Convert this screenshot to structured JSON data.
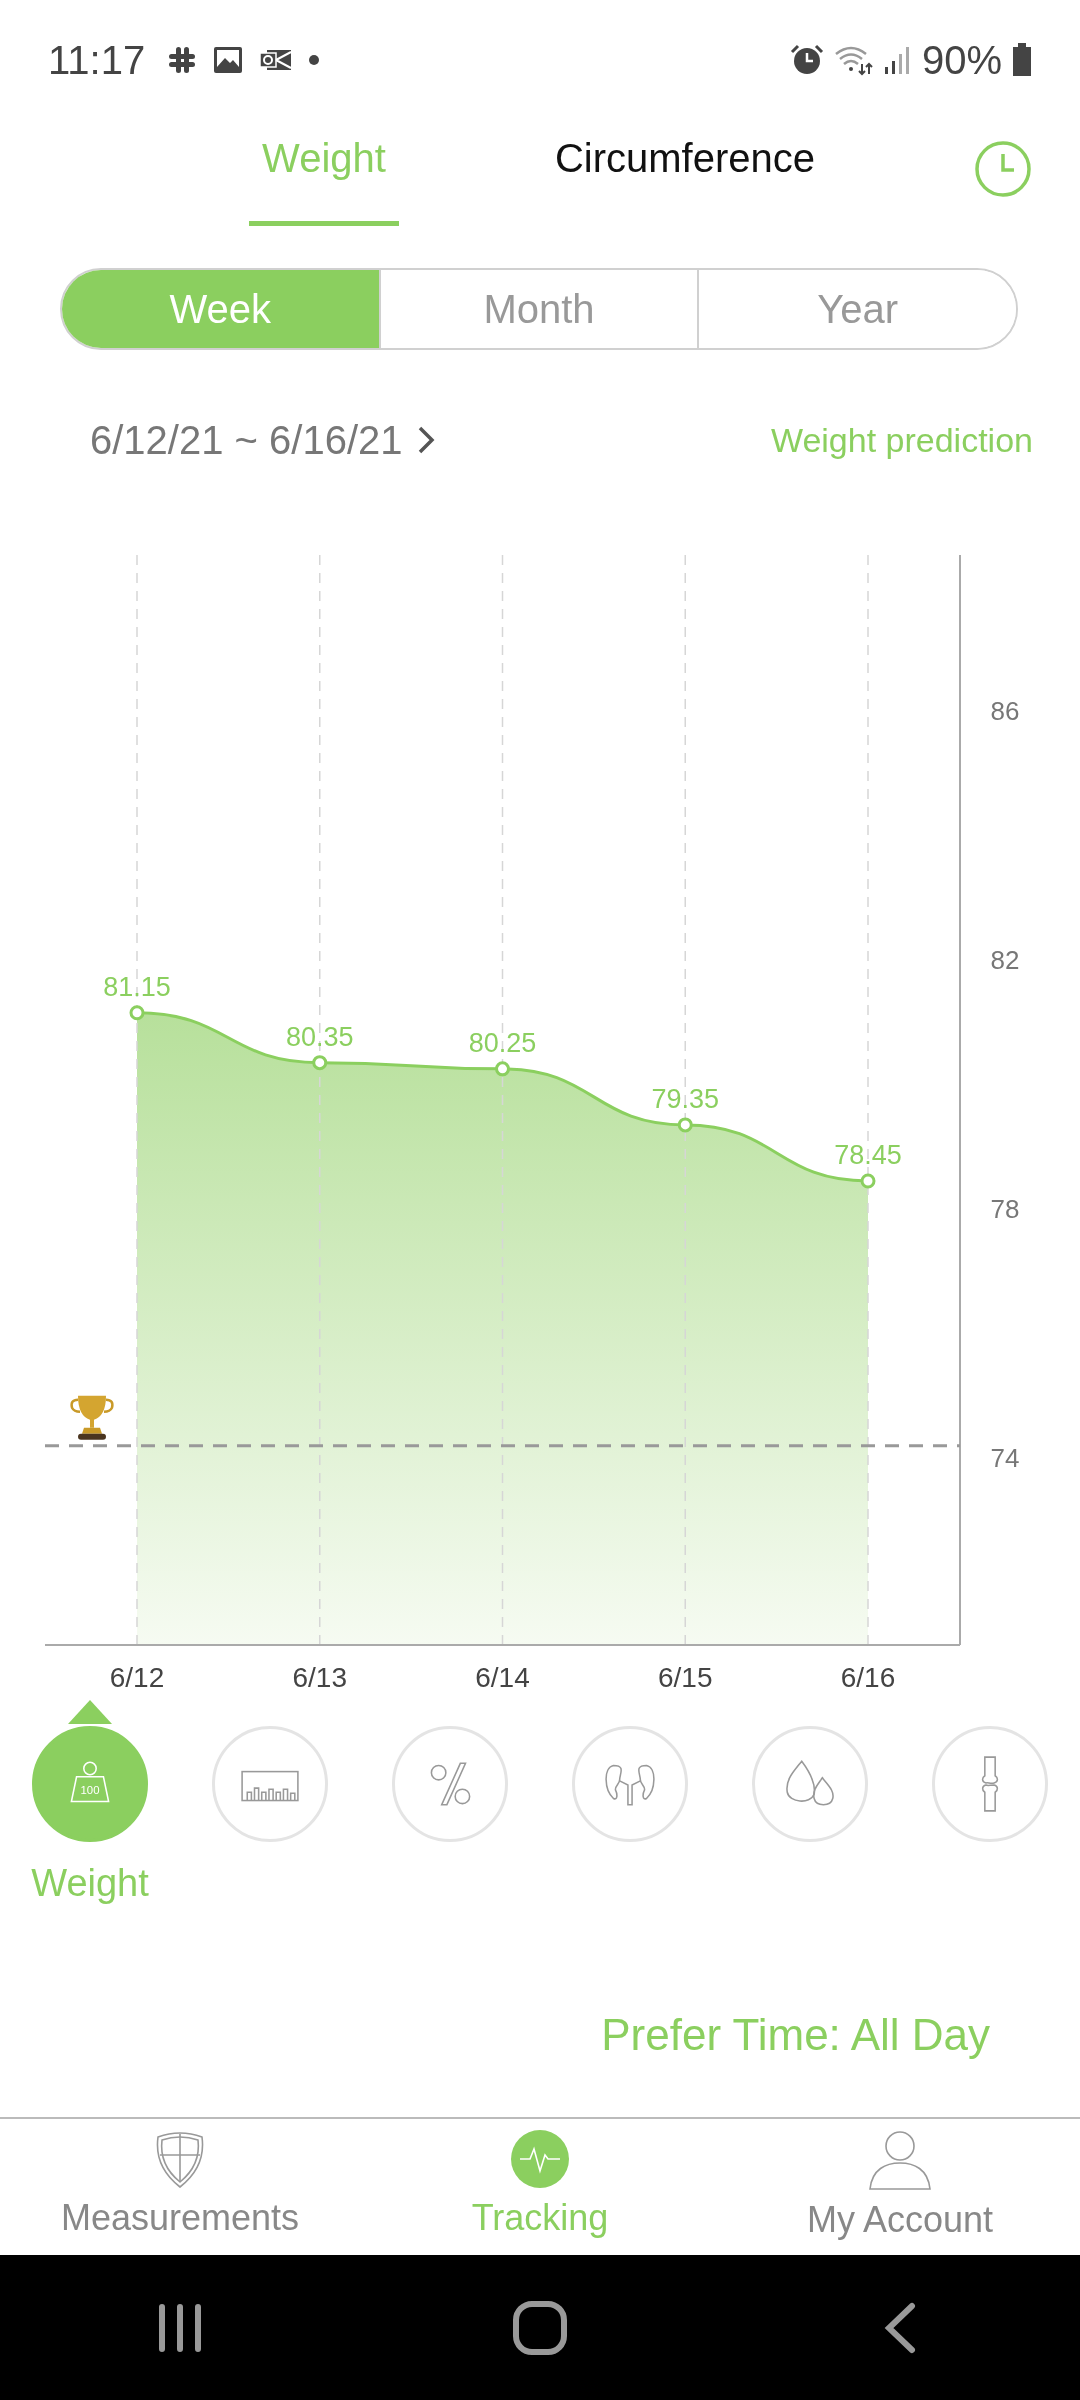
{
  "status_bar": {
    "time": "11:17",
    "battery": "90%"
  },
  "tabs": [
    {
      "label": "Weight",
      "selected": true
    },
    {
      "label": "Circumference",
      "selected": false
    }
  ],
  "periods": [
    {
      "label": "Week",
      "selected": true
    },
    {
      "label": "Month",
      "selected": false
    },
    {
      "label": "Year",
      "selected": false
    }
  ],
  "date_range": "6/12/21 ~ 6/16/21",
  "prediction_link": "Weight prediction",
  "chart": {
    "chart_data": {
      "type": "area",
      "categories": [
        "6/12",
        "6/13",
        "6/14",
        "6/15",
        "6/16"
      ],
      "series": [
        {
          "color": "#8bcf5f",
          "values": [
            81.15,
            80.35,
            80.25,
            79.35,
            78.45
          ]
        }
      ],
      "ylim": [
        71,
        88.5
      ],
      "yticks": [
        74,
        78,
        82,
        86
      ],
      "data_labels": true,
      "grid": true,
      "ref_lines": [
        {
          "axis": "y",
          "value": 74.2
        }
      ]
    }
  },
  "metrics": [
    {
      "kind": "weight",
      "label": "Weight",
      "icon_text": "100",
      "selected": true
    },
    {
      "kind": "ruler",
      "selected": false
    },
    {
      "kind": "percent",
      "selected": false
    },
    {
      "kind": "kidney",
      "selected": false
    },
    {
      "kind": "drops",
      "selected": false
    },
    {
      "kind": "joint",
      "selected": false
    }
  ],
  "prefer_time": "Prefer Time: All Day",
  "nav": [
    {
      "kind": "shield",
      "label": "Measurements",
      "selected": false
    },
    {
      "kind": "pulse",
      "label": "Tracking",
      "selected": true
    },
    {
      "kind": "person",
      "label": "My Account",
      "selected": false
    }
  ]
}
